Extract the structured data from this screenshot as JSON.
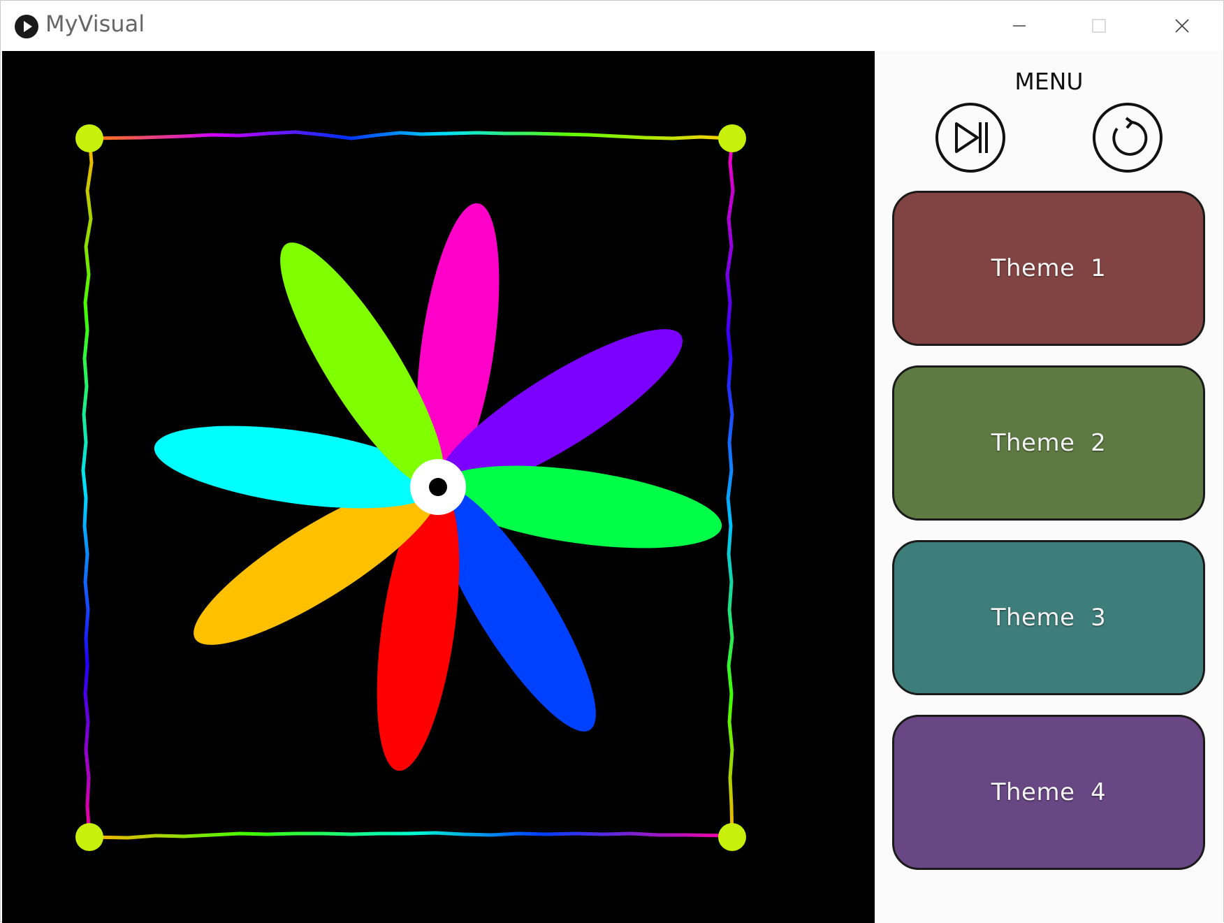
{
  "window": {
    "title": "MyVisual",
    "controls": [
      "minimize-icon",
      "maximize-icon",
      "close-icon"
    ]
  },
  "visual": {
    "background": "#000000",
    "corner_color": "#c8f00a",
    "petals": [
      {
        "color": "#ff00c8"
      },
      {
        "color": "#7b00ff"
      },
      {
        "color": "#00ff48"
      },
      {
        "color": "#0040ff"
      },
      {
        "color": "#ff0000"
      },
      {
        "color": "#ffc000"
      },
      {
        "color": "#00ffff"
      },
      {
        "color": "#80ff00"
      }
    ],
    "center_color": "#ffffff"
  },
  "menu": {
    "title": "MENU",
    "buttons": [
      {
        "icon": "play-pause-icon"
      },
      {
        "icon": "reset-icon"
      }
    ],
    "themes": [
      {
        "label": "Theme  1",
        "color": "#824443"
      },
      {
        "label": "Theme  2",
        "color": "#5e7a42"
      },
      {
        "label": "Theme  3",
        "color": "#3e7e7a"
      },
      {
        "label": "Theme  4",
        "color": "#684784"
      }
    ]
  }
}
